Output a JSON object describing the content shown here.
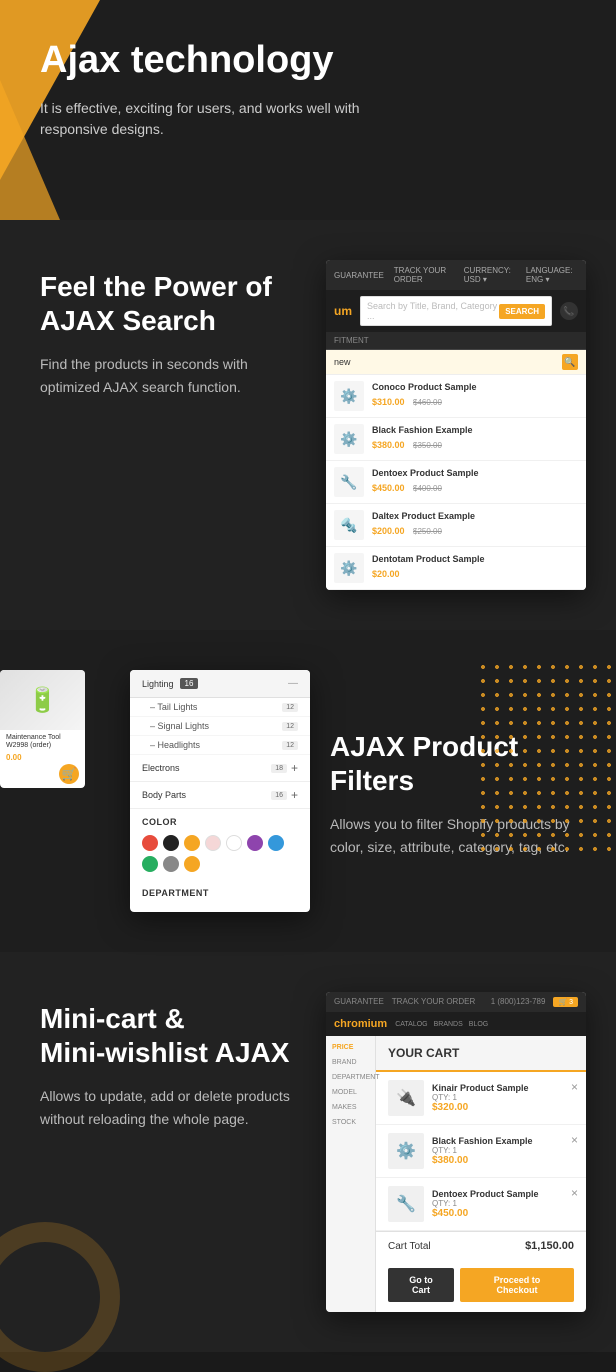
{
  "hero": {
    "title": "Ajax technology",
    "subtitle": "It is effective, exciting for users, and works well with responsive designs."
  },
  "ajaxSearch": {
    "title_line1": "Feel the Power of",
    "title_line2": "AJAX Search",
    "description": "Find the products in seconds with optimized AJAX search function.",
    "mockup": {
      "topbar_items": [
        "GUARANTEE",
        "TRACK YOUR ORDER"
      ],
      "currency": "CURRENCY: USD",
      "language": "LANGUAGE: ENG",
      "logo": "um",
      "search_placeholder": "Search by Title, Brand, Category ...",
      "search_btn": "SEARCH",
      "tabs": [
        "FITMENT"
      ],
      "search_input": "new",
      "results": [
        {
          "icon": "⚙️",
          "name": "Conoco Product Sample",
          "price_new": "$310.00",
          "price_old": "$460.00"
        },
        {
          "icon": "⚙️",
          "name": "Black Fashion Example",
          "price_new": "$380.00",
          "price_old": "$350.00"
        },
        {
          "icon": "🔧",
          "name": "Dentoex Product Sample",
          "price_new": "$450.00",
          "price_old": "$400.00"
        },
        {
          "icon": "🔩",
          "name": "Daltex Product Example",
          "price_new": "$200.00",
          "price_old": "$250.00"
        },
        {
          "icon": "⚙️",
          "name": "Dentotam Product Sample",
          "price_new": "$20.00",
          "price_old": ""
        }
      ]
    }
  },
  "ajaxFilters": {
    "title": "AJAX Product Filters",
    "description": "Allows you to filter Shopify products by color, size, attribute, category, tag, etc.",
    "mockup": {
      "categories": [
        {
          "name": "Lighting",
          "count": "16",
          "expanded": true
        },
        {
          "name": "Tail Lights",
          "count": "12",
          "indent": true
        },
        {
          "name": "Signal Lights",
          "count": "12",
          "indent": true
        },
        {
          "name": "Headlights",
          "count": "12",
          "indent": true
        },
        {
          "name": "Electrons",
          "count": "18"
        },
        {
          "name": "Body Parts",
          "count": "16"
        }
      ],
      "color_label": "COLOR",
      "colors": [
        "#e74c3c",
        "#222222",
        "#f5a623",
        "#f5d7d7",
        "#fff",
        "#8e44ad",
        "#3498db",
        "#27ae60",
        "#888",
        "#f5a623"
      ],
      "department_label": "DEPARTMENT"
    },
    "product_strip": {
      "name": "Maintenance Tool W2998 (order)",
      "price": "0.00"
    }
  },
  "minicart": {
    "title_line1": "Mini-cart &",
    "title_line2": "Mini-wishlist AJAX",
    "description": "Allows to update, add or delete products without reloading the whole page.",
    "mockup": {
      "topbar_items": [
        "GUARANTEE",
        "TRACK YOUR ORDER"
      ],
      "logo": "chromium",
      "nav_items": [
        "CATALOG",
        "BRANDS",
        "BLOG"
      ],
      "cart_header": "YOUR CART",
      "items": [
        {
          "icon": "🔌",
          "name": "Kinair Product Sample",
          "qty": "QTY: 1",
          "price": "$320.00"
        },
        {
          "icon": "⚙️",
          "name": "Black Fashion Example",
          "qty": "QTY: 1",
          "price": "$380.00"
        },
        {
          "icon": "🔧",
          "name": "Dentoex Product Sample",
          "qty": "QTY: 1",
          "price": "$450.00"
        }
      ],
      "total_label": "Cart Total",
      "total_amount": "$1,150.00",
      "btn_cart": "Go to Cart",
      "btn_checkout": "Proceed to Checkout"
    }
  }
}
